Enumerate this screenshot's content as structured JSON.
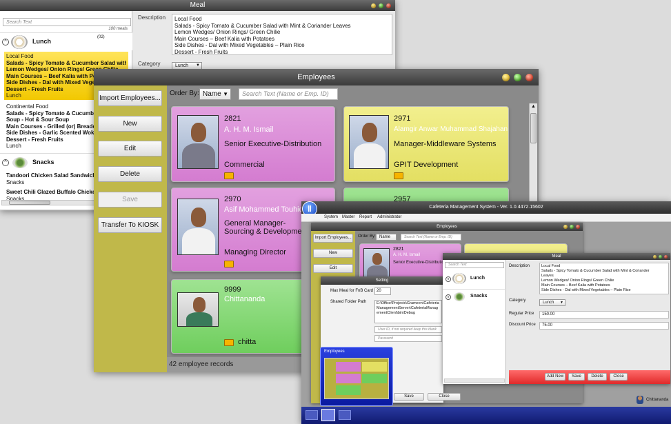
{
  "meal_window": {
    "title": "Meal",
    "search_placeholder": "Search Text",
    "search_count": "100 meals",
    "groups": [
      {
        "name": "Lunch",
        "count": "(02)",
        "items": [
          {
            "lines": [
              "Local Food",
              "Salads - Spicy Tomato & Cucumber Salad with Mint &",
              "Lemon Wedges/ Onion Rings/ Green Chilie",
              "Main Courses – Beef Kalia with Potatoes",
              "Side Dishes - Dal with Mixed Vegetables",
              "Dessert - Fresh Fruits",
              "Lunch"
            ]
          },
          {
            "lines": [
              "Continental Food",
              "Salads - Spicy Tomato & Cucumber Salad",
              "Soup - Hot & Sour Soup",
              "Main Courses - Grilled (or) Breaded-fried",
              "Side Dishes - Garlic Scented Wok-fried",
              "Dessert - Fresh Fruits",
              "Lunch"
            ]
          }
        ]
      },
      {
        "name": "Snacks",
        "count": "",
        "items": [
          {
            "lines": [
              "Tandoori Chicken Salad Sandwich [100",
              "Snacks"
            ]
          },
          {
            "lines": [
              "Sweet Chili Glazed Buffalo Chicken Wi",
              "Snacks"
            ]
          }
        ]
      }
    ],
    "description_label": "Description",
    "description_lines": [
      "Local Food",
      "Salads - Spicy Tomato & Cucumber Salad with Mint & Coriander Leaves",
      "Lemon Wedges/ Onion Rings/ Green Chilie",
      "Main Courses – Beef Kalia with Potatoes",
      "Side Dishes - Dal with Mixed Vegetables – Plain Rice",
      "Dessert - Fresh Fruits"
    ],
    "category_label": "Category",
    "category_value": "Lunch"
  },
  "employees_window": {
    "title": "Employees",
    "buttons": {
      "import": "Import Employees...",
      "new": "New",
      "edit": "Edit",
      "delete": "Delete",
      "save": "Save",
      "transfer": "Transfer To KIOSK"
    },
    "order_label": "Order By:",
    "order_value": "Name",
    "search_placeholder": "Search Text (Name or Emp. ID)",
    "status": "42 employee records",
    "cards": [
      {
        "id": "2821",
        "name": "A. H. M. Ismail",
        "title": "Senior Executive-Distribution",
        "dept": "Commercial",
        "color": "pink"
      },
      {
        "id": "2971",
        "name": "Alamgir Anwar Muhammad Shajahan",
        "title": "Manager-Middleware Systems",
        "dept": "GPIT Development",
        "color": "yel"
      },
      {
        "id": "2970",
        "name": "Asif Mohammed Touhid",
        "title": "General Manager-Sourcing & Development",
        "dept": "Managing Director",
        "color": "pink"
      },
      {
        "id": "2957",
        "name": "",
        "title": "",
        "dept": "",
        "color": "grn"
      },
      {
        "id": "9999",
        "name": "Chittananda",
        "title": "",
        "dept": "chitta",
        "color": "grn"
      }
    ]
  },
  "cms_window": {
    "title": "Cafeteria Management System - Ver. 1.0.4472.15602",
    "menu": [
      "System",
      "Master",
      "Report",
      "Administrator"
    ],
    "mini_employees": {
      "title": "Employees",
      "import": "Import Employees...",
      "new": "New",
      "edit": "Edit",
      "order_label": "Order By:",
      "order_value": "Name",
      "search_placeholder": "Search Text (Name or Emp. ID)",
      "card_id": "2821",
      "card_name": "A. H. M. Ismail",
      "card_title": "Senior Executive-Distribution"
    },
    "setting": {
      "title": "Setting",
      "max_meal_label": "Max Meal for FnB Card",
      "max_meal_value": "20",
      "shared_label": "Shared Folder Path",
      "shared_value": "E:\\Office\\Projects\\Grameen\\CafeteriaManagementServer\\CafeteriaManagementClient\\bin\\Debug",
      "user_placeholder": "User ID, if not required keep this blank",
      "password_placeholder": "Password",
      "save": "Save",
      "close": "Close"
    },
    "mini_meal": {
      "title": "Meal",
      "search_placeholder": "Search Text",
      "groups": [
        "Lunch",
        "Snacks"
      ],
      "description_label": "Description",
      "description_lines": [
        "Local Food",
        "Salads - Spicy Tomato & Cucumber Salad with Mint & Coriander",
        "Leaves",
        "Lemon Wedges/ Onion Rings/ Green Chilie",
        "Main Courses – Beef Kalia with Potatoes",
        "Side Dishes - Dal with Mixed Vegetables – Plain Rice"
      ],
      "category_label": "Category",
      "category_value": "Lunch",
      "regular_label": "Regular Price",
      "regular_value": "150.00",
      "discount_label": "Discount Price",
      "discount_value": "75.00",
      "buttons": [
        "Add New",
        "Save",
        "Delete",
        "Close"
      ]
    },
    "thumbnail_title": "Employees",
    "user": "Chittananda"
  }
}
